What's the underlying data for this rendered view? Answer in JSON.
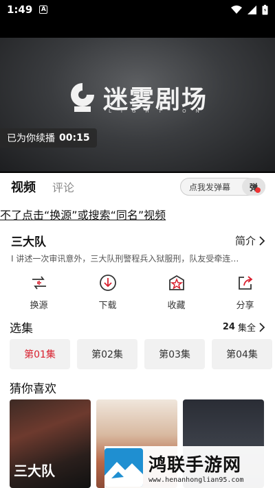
{
  "status": {
    "time": "1:49",
    "badge": "A"
  },
  "player": {
    "logo_text": "迷雾剧场",
    "logo_sub": "LIGHT ON",
    "resume_text": "已为你续播",
    "resume_time": "00:15"
  },
  "tabs": [
    {
      "label": "视频"
    },
    {
      "label": "评论"
    }
  ],
  "danmu": {
    "placeholder": "点我发弹幕",
    "toggle": "弹"
  },
  "notice": "不了点击“换源”或搜索“同名”视频",
  "show": {
    "title": "三大队",
    "intro_label": "简介",
    "description": "I 讲述一次审讯意外，三大队刑警程兵入狱服刑，队友受牵连…"
  },
  "actions": [
    {
      "label": "换源",
      "icon": "switch-source-icon"
    },
    {
      "label": "下载",
      "icon": "download-icon"
    },
    {
      "label": "收藏",
      "icon": "favorite-icon"
    },
    {
      "label": "分享",
      "icon": "share-icon"
    }
  ],
  "episodes": {
    "title": "选集",
    "count_num": "24",
    "count_label": "集全",
    "items": [
      {
        "label": "第01集"
      },
      {
        "label": "第02集"
      },
      {
        "label": "第03集"
      },
      {
        "label": "第04集"
      }
    ]
  },
  "recommend": {
    "title": "猜你喜欢",
    "items": [
      {
        "caption": "三大队"
      },
      {
        "caption": ""
      },
      {
        "caption": ""
      }
    ]
  },
  "watermark": {
    "name": "鸿联手游网",
    "url": "www.henanhonglian95.com"
  },
  "colors": {
    "accent": "#d8202e"
  }
}
